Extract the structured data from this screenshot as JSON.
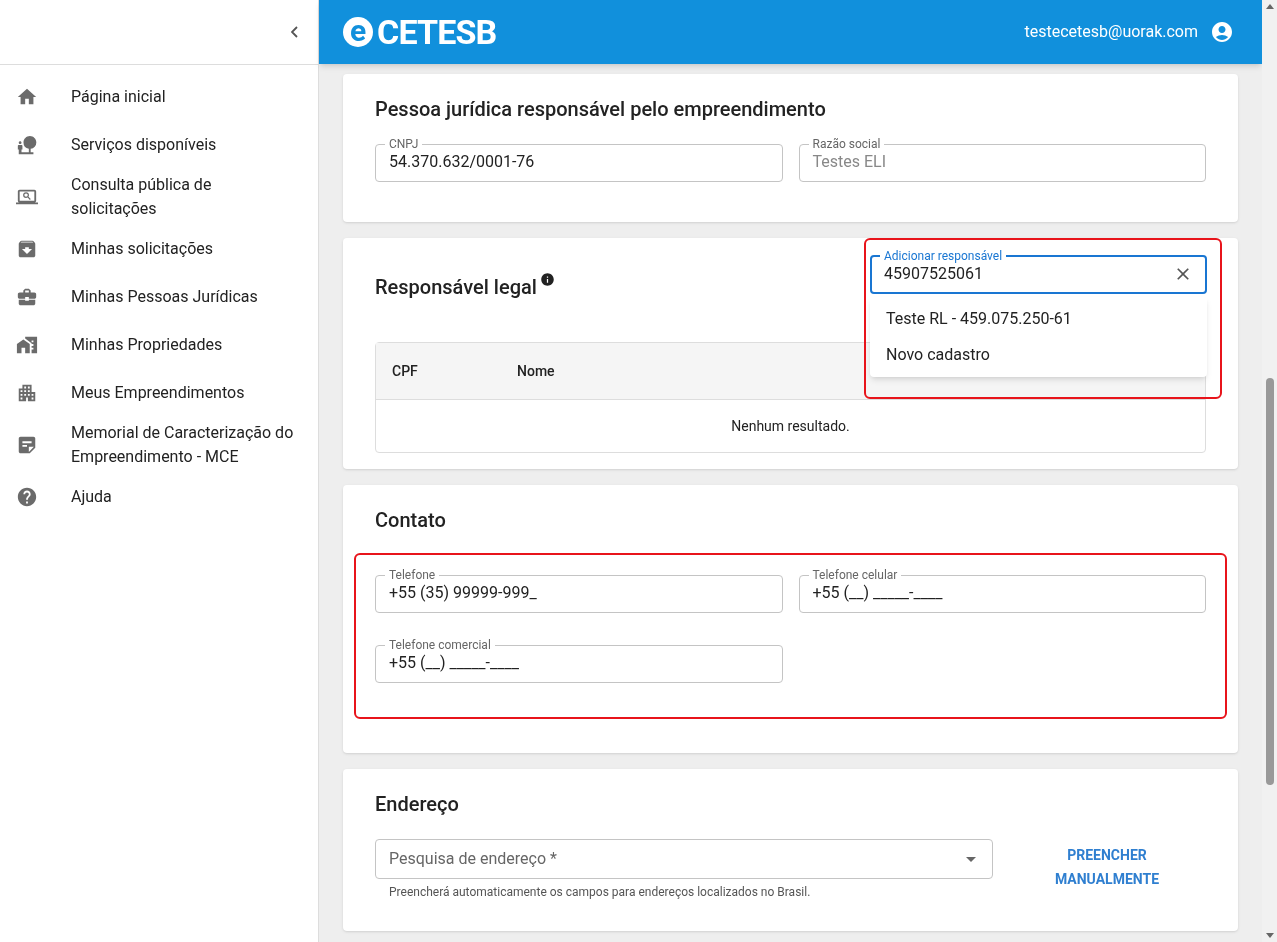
{
  "sidebar": {
    "items": [
      {
        "label": "Página inicial"
      },
      {
        "label": "Serviços disponíveis"
      },
      {
        "label": "Consulta pública de solicitações"
      },
      {
        "label": "Minhas solicitações"
      },
      {
        "label": "Minhas Pessoas Jurídicas"
      },
      {
        "label": "Minhas Propriedades"
      },
      {
        "label": "Meus Empreendimentos"
      },
      {
        "label": "Memorial de Caracterização do Empreendimento - MCE"
      },
      {
        "label": "Ajuda"
      }
    ]
  },
  "header": {
    "logo": {
      "mark": "e",
      "text": "CETESB"
    },
    "user_email": "testecetesb@uorak.com"
  },
  "pessoa_juridica": {
    "title": "Pessoa jurídica responsável pelo empreendimento",
    "fields": [
      {
        "label": "CNPJ",
        "value": "54.370.632/0001-76",
        "disabled": false
      },
      {
        "label": "Razão social",
        "value": "Testes ELI",
        "disabled": true
      }
    ]
  },
  "responsavel_legal": {
    "title": "Responsável legal",
    "highlighted": true,
    "search": {
      "label": "Adicionar responsável",
      "value": "45907525061",
      "focused": true
    },
    "options": [
      {
        "label": "Teste RL - 459.075.250-61"
      },
      {
        "label": "Novo cadastro"
      }
    ],
    "table": {
      "columns": [
        "CPF",
        "Nome"
      ],
      "empty_message": "Nenhum resultado."
    }
  },
  "contato": {
    "title": "Contato",
    "highlighted": true,
    "fields": [
      {
        "label": "Telefone",
        "value": "+55 (35) 99999-999_"
      },
      {
        "label": "Telefone celular",
        "value": "+55 (__) _____-____"
      },
      {
        "label": "Telefone comercial",
        "value": "+55 (__) _____-____"
      }
    ]
  },
  "endereco": {
    "title": "Endereço",
    "search": {
      "placeholder": "Pesquisa de endereço *",
      "helper": "Preencherá automaticamente os campos para endereços localizados no Brasil."
    },
    "button": "PREENCHER MANUALMENTE"
  }
}
